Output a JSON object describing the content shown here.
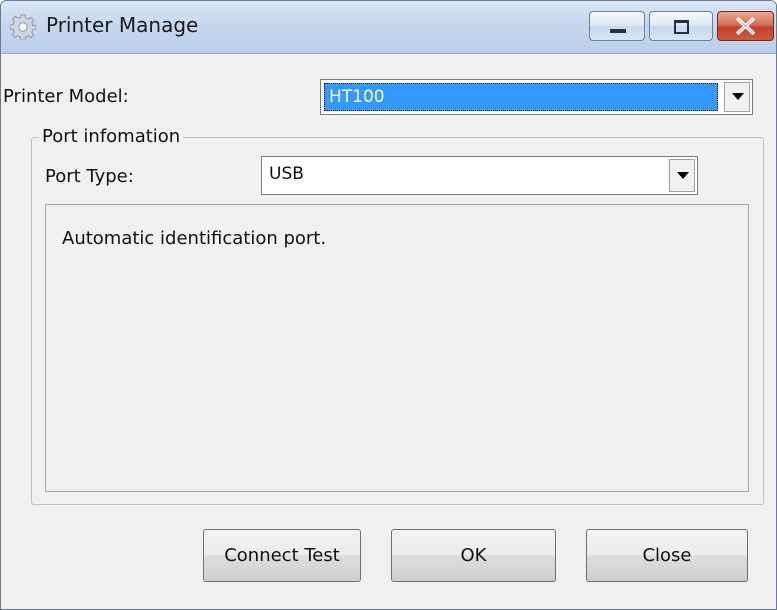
{
  "window": {
    "title": "Printer Manage",
    "icon": "gear-icon"
  },
  "title_buttons": {
    "minimize_icon": "minimize-icon",
    "maximize_icon": "maximize-icon",
    "close_icon": "close-icon",
    "close_color": "#c7432a"
  },
  "printer_model": {
    "label": "Printer Model:",
    "value": "HT100",
    "selected_highlight": "#3399ff"
  },
  "port_info": {
    "group_title": "Port infomation",
    "port_type_label": "Port Type:",
    "port_type_value": "USB",
    "message": "Automatic identification port."
  },
  "buttons": {
    "connect_test": "Connect Test",
    "ok": "OK",
    "close": "Close"
  }
}
